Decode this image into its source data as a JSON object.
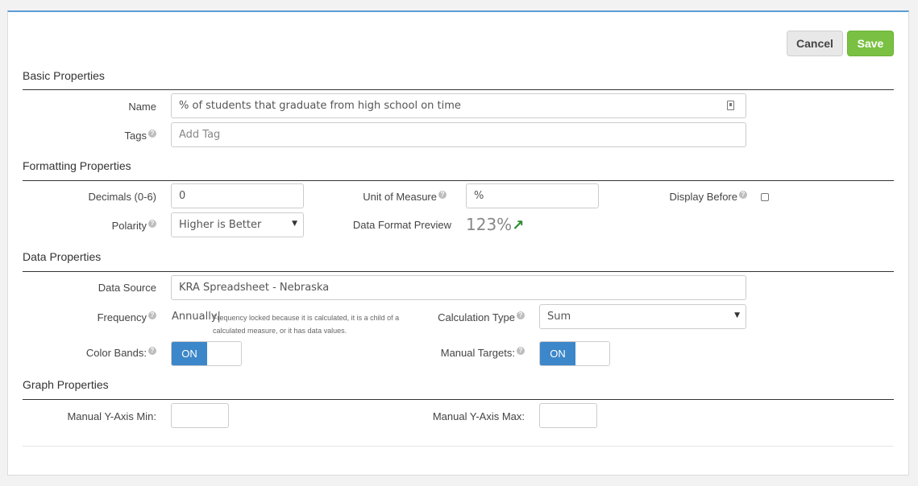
{
  "toolbar": {
    "cancel_label": "Cancel",
    "save_label": "Save"
  },
  "basic": {
    "title": "Basic Properties",
    "name_label": "Name",
    "name_value": "% of students that graduate from high school on time",
    "tags_label": "Tags",
    "tags_placeholder": "Add Tag"
  },
  "formatting": {
    "title": "Formatting Properties",
    "decimals_label": "Decimals (0-6)",
    "decimals_value": "0",
    "unit_label": "Unit of Measure",
    "unit_value": "%",
    "display_before_label": "Display Before",
    "display_before_checked": false,
    "polarity_label": "Polarity",
    "polarity_value": "Higher is Better",
    "preview_label": "Data Format Preview",
    "preview_value": "123%",
    "preview_trend": "up-right-arrow",
    "trend_color": "#2a8a2a"
  },
  "data": {
    "title": "Data Properties",
    "source_label": "Data Source",
    "source_value": "KRA Spreadsheet - Nebraska",
    "frequency_label": "Frequency",
    "frequency_value": "Annually|",
    "frequency_note": "Frequency locked because it is calculated, it is a child of a calculated measure, or it has data values.",
    "calc_label": "Calculation Type",
    "calc_value": "Sum",
    "color_bands_label": "Color Bands:",
    "color_bands_state": "ON",
    "manual_targets_label": "Manual Targets:",
    "manual_targets_state": "ON"
  },
  "graph": {
    "title": "Graph Properties",
    "ymin_label": "Manual Y-Axis Min:",
    "ymin_value": "",
    "ymax_label": "Manual Y-Axis Max:",
    "ymax_value": ""
  },
  "colors": {
    "accent": "#3c87c9",
    "save": "#7ac143",
    "top_border": "#5b9bd5"
  }
}
